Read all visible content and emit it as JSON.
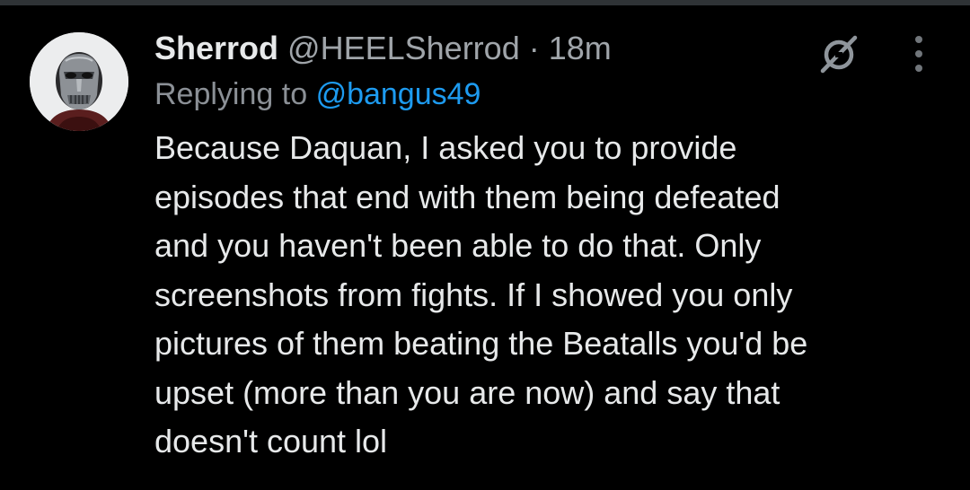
{
  "tweet": {
    "display_name": "Sherrod",
    "handle": "@HEELSherrod",
    "separator": "·",
    "time": "18m",
    "replying_prefix": "Replying to",
    "replying_to": "@bangus49",
    "body_lines": [
      "Because Daquan, I asked you to provide",
      "episodes that end with them being defeated",
      "and you haven't been able to do that. Only",
      "screenshots from fights. If I showed you only",
      "pictures of them beating the Beatalls you'd be",
      "upset (more than you are now) and say that",
      "doesn't count lol"
    ]
  },
  "icons": {
    "avatar": "masked-figure-avatar",
    "grok": "grok-icon",
    "more": "more-options-icon"
  },
  "colors": {
    "background": "#000000",
    "text": "#e7e9ea",
    "muted": "#8b9096",
    "mention": "#1d9bf0"
  }
}
